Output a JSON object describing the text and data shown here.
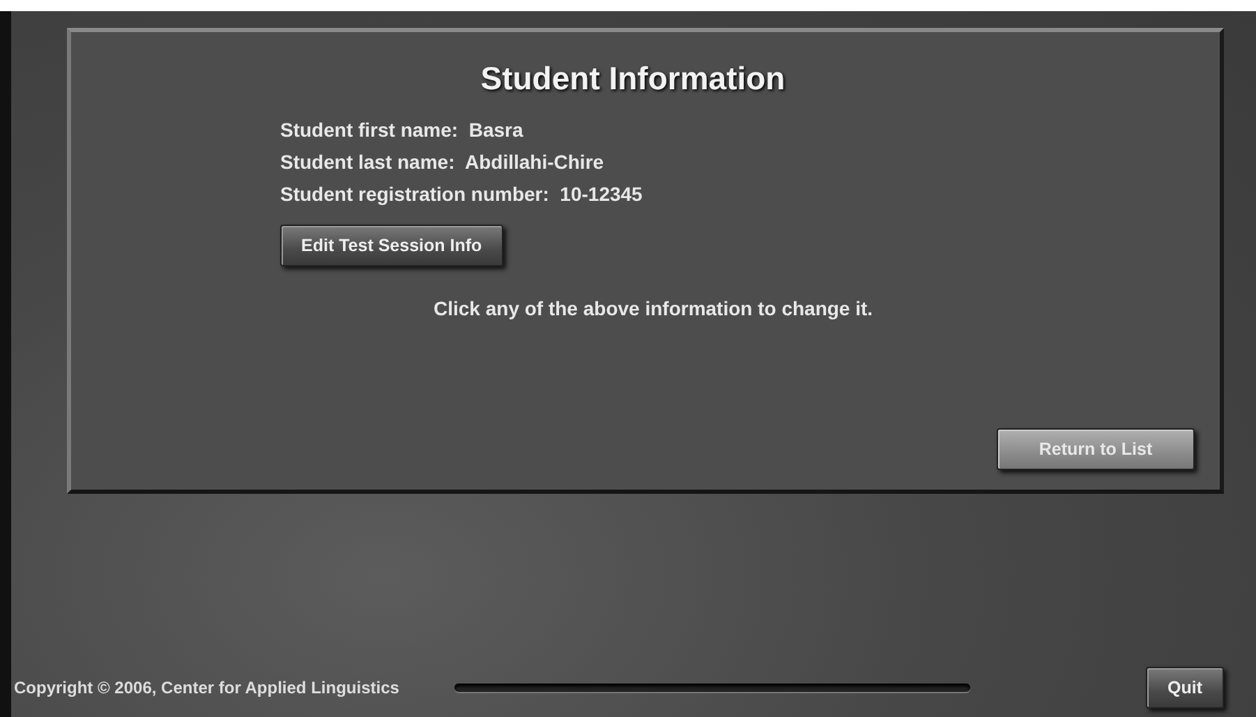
{
  "panel": {
    "title": "Student Information",
    "fields": [
      {
        "label": "Student first name:",
        "value": "Basra"
      },
      {
        "label": "Student last name:",
        "value": "Abdillahi-Chire"
      },
      {
        "label": "Student registration number:",
        "value": "10-12345"
      }
    ],
    "edit_button": "Edit Test Session Info",
    "hint": "Click any of the above information to change it.",
    "return_button": "Return to List"
  },
  "footer": {
    "copyright": "Copyright © 2006, Center for Applied Linguistics",
    "quit_button": "Quit"
  }
}
